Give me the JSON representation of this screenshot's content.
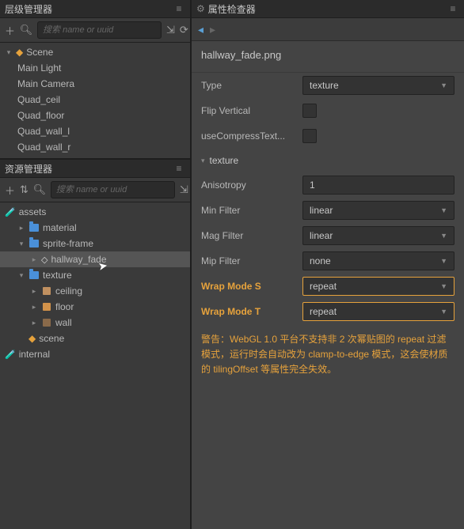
{
  "hierarchy": {
    "title": "层级管理器",
    "search_placeholder": "搜索 name or uuid",
    "scene": "Scene",
    "items": [
      "Main Light",
      "Main Camera",
      "Quad_ceil",
      "Quad_floor",
      "Quad_wall_l",
      "Quad_wall_r"
    ]
  },
  "assets": {
    "title": "资源管理器",
    "search_placeholder": "搜索 name or uuid",
    "root": "assets",
    "material": "material",
    "sprite_frame": "sprite-frame",
    "hallway_fade": "hallway_fade",
    "texture": "texture",
    "ceiling": "ceiling",
    "floor": "floor",
    "wall": "wall",
    "scene": "scene",
    "internal": "internal"
  },
  "inspector": {
    "title": "属性检查器",
    "name": "hallway_fade.png",
    "type_label": "Type",
    "type_value": "texture",
    "flip_label": "Flip Vertical",
    "compress_label": "useCompressText...",
    "section": "texture",
    "aniso_label": "Anisotropy",
    "aniso_value": "1",
    "minfilter_label": "Min Filter",
    "minfilter_value": "linear",
    "magfilter_label": "Mag Filter",
    "magfilter_value": "linear",
    "mipfilter_label": "Mip Filter",
    "mipfilter_value": "none",
    "wraps_label": "Wrap Mode S",
    "wraps_value": "repeat",
    "wrapt_label": "Wrap Mode T",
    "wrapt_value": "repeat",
    "warning": "警告：WebGL 1.0 平台不支持非 2 次幂贴图的 repeat 过滤模式，运行时会自动改为 clamp-to-edge 模式，这会使材质的 tilingOffset 等属性完全失效。"
  }
}
